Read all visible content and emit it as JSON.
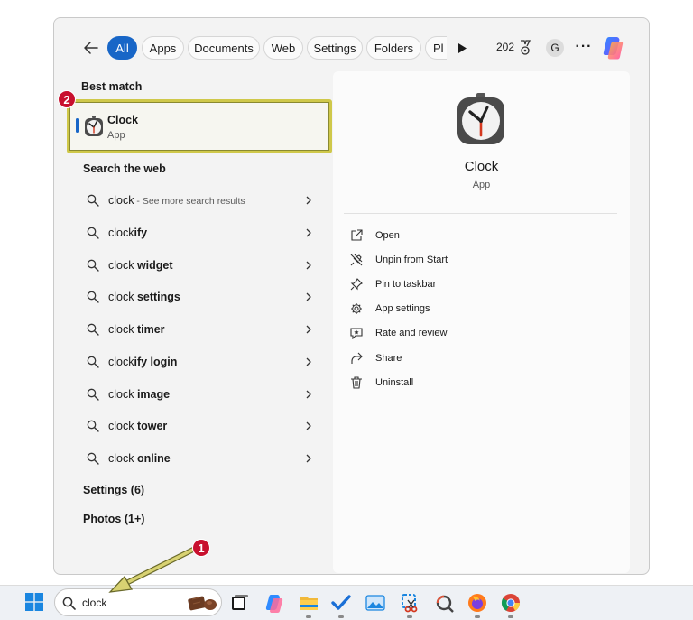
{
  "filters": {
    "tabs": [
      {
        "label": "All",
        "active": true
      },
      {
        "label": "Apps"
      },
      {
        "label": "Documents"
      },
      {
        "label": "Web"
      },
      {
        "label": "Settings"
      },
      {
        "label": "Folders"
      },
      {
        "label": "Pl"
      }
    ],
    "points": "202",
    "account_initial": "G",
    "more_label": "···"
  },
  "best_match": {
    "title": "Best match",
    "app_name": "Clock",
    "app_type": "App"
  },
  "search_web": {
    "title": "Search the web",
    "items": [
      {
        "prefix": "clock",
        "bold": "",
        "suffix": " - See more search results"
      },
      {
        "prefix": "clock",
        "bold": "ify",
        "suffix": ""
      },
      {
        "prefix": "clock ",
        "bold": "widget",
        "suffix": ""
      },
      {
        "prefix": "clock ",
        "bold": "settings",
        "suffix": ""
      },
      {
        "prefix": "clock ",
        "bold": "timer",
        "suffix": ""
      },
      {
        "prefix": "clock",
        "bold": "ify login",
        "suffix": ""
      },
      {
        "prefix": "clock ",
        "bold": "image",
        "suffix": ""
      },
      {
        "prefix": "clock ",
        "bold": "tower",
        "suffix": ""
      },
      {
        "prefix": "clock ",
        "bold": "online",
        "suffix": ""
      }
    ]
  },
  "categories": {
    "settings": "Settings (6)",
    "photos": "Photos (1+)"
  },
  "detail": {
    "app_name": "Clock",
    "app_type": "App",
    "actions": [
      {
        "label": "Open",
        "icon": "open-external-icon"
      },
      {
        "label": "Unpin from Start",
        "icon": "unpin-icon"
      },
      {
        "label": "Pin to taskbar",
        "icon": "pin-icon"
      },
      {
        "label": "App settings",
        "icon": "gear-icon"
      },
      {
        "label": "Rate and review",
        "icon": "star-review-icon"
      },
      {
        "label": "Share",
        "icon": "share-icon"
      },
      {
        "label": "Uninstall",
        "icon": "trash-icon"
      }
    ]
  },
  "taskbar": {
    "search_value": "clock"
  },
  "annotations": {
    "badge1": "1",
    "badge2": "2"
  },
  "colors": {
    "accent": "#1866c7",
    "highlight_border": "#cfc84a",
    "badge_red": "#c8102e"
  }
}
